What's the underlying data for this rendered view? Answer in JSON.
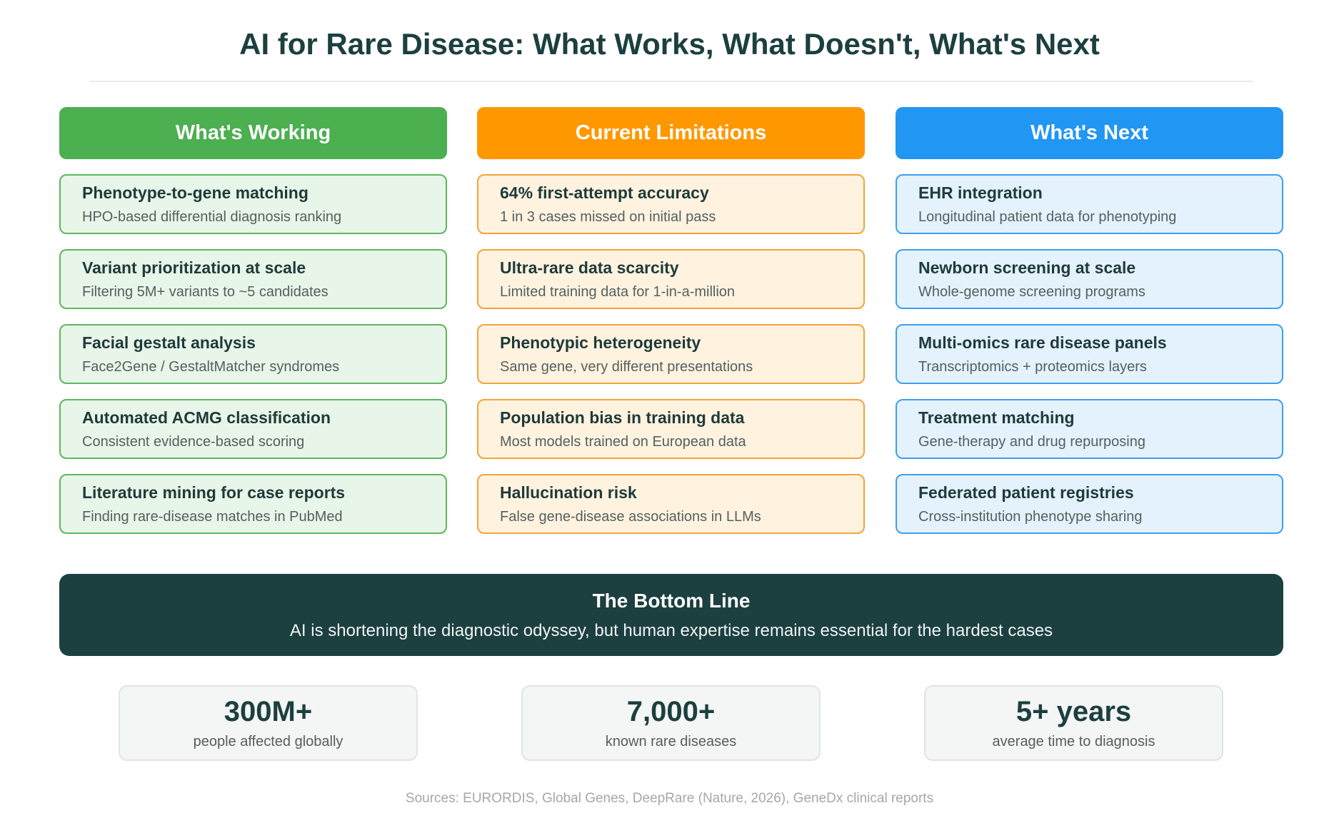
{
  "title": "AI for Rare Disease: What Works, What Doesn't, What's Next",
  "columns": [
    {
      "header": "What's Working",
      "items": [
        {
          "title": "Phenotype-to-gene matching",
          "desc": "HPO-based differential diagnosis ranking"
        },
        {
          "title": "Variant prioritization at scale",
          "desc": "Filtering 5M+ variants to ~5 candidates"
        },
        {
          "title": "Facial gestalt analysis",
          "desc": "Face2Gene / GestaltMatcher syndromes"
        },
        {
          "title": "Automated ACMG classification",
          "desc": "Consistent evidence-based scoring"
        },
        {
          "title": "Literature mining for case reports",
          "desc": "Finding rare-disease matches in PubMed"
        }
      ]
    },
    {
      "header": "Current Limitations",
      "items": [
        {
          "title": "64% first-attempt accuracy",
          "desc": "1 in 3 cases missed on initial pass"
        },
        {
          "title": "Ultra-rare data scarcity",
          "desc": "Limited training data for 1-in-a-million"
        },
        {
          "title": "Phenotypic heterogeneity",
          "desc": "Same gene, very different presentations"
        },
        {
          "title": "Population bias in training data",
          "desc": "Most models trained on European data"
        },
        {
          "title": "Hallucination risk",
          "desc": "False gene-disease associations in LLMs"
        }
      ]
    },
    {
      "header": "What's Next",
      "items": [
        {
          "title": "EHR integration",
          "desc": "Longitudinal patient data for phenotyping"
        },
        {
          "title": "Newborn screening at scale",
          "desc": "Whole-genome screening programs"
        },
        {
          "title": "Multi-omics rare disease panels",
          "desc": "Transcriptomics + proteomics layers"
        },
        {
          "title": "Treatment matching",
          "desc": "Gene-therapy and drug repurposing"
        },
        {
          "title": "Federated patient registries",
          "desc": "Cross-institution phenotype sharing"
        }
      ]
    }
  ],
  "bottom_line": {
    "title": "The Bottom Line",
    "text": "AI is shortening the diagnostic odyssey, but human expertise remains essential for the hardest cases"
  },
  "stats": [
    {
      "value": "300M+",
      "label": "people affected globally"
    },
    {
      "value": "7,000+",
      "label": "known rare diseases"
    },
    {
      "value": "5+ years",
      "label": "average time to diagnosis"
    }
  ],
  "sources": "Sources: EURORDIS, Global Genes, DeepRare (Nature, 2026), GeneDx clinical reports",
  "colors": {
    "working": "#4caf50",
    "limitations": "#ff9800",
    "next": "#2196f3",
    "dark": "#1c3f3f"
  }
}
